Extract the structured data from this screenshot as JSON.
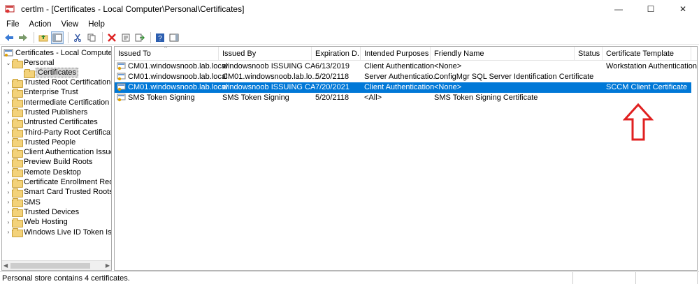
{
  "window": {
    "title": "certlm - [Certificates - Local Computer\\Personal\\Certificates]",
    "minimize": "—",
    "maximize": "☐",
    "close": "✕"
  },
  "menu": [
    "File",
    "Action",
    "View",
    "Help"
  ],
  "toolbar_icons": [
    "back-arrow-icon",
    "forward-arrow-icon",
    "up-folder-icon",
    "show-hide-tree-icon",
    "cut-icon",
    "copy-icon",
    "delete-icon",
    "properties-icon",
    "export-list-icon",
    "help-icon",
    "action-pane-icon"
  ],
  "tree": {
    "root": "Certificates - Local Computer",
    "personal": "Personal",
    "certificates": "Certificates",
    "stores": [
      "Trusted Root Certification Au",
      "Enterprise Trust",
      "Intermediate Certification Au",
      "Trusted Publishers",
      "Untrusted Certificates",
      "Third-Party Root Certification",
      "Trusted People",
      "Client Authentication Issuers",
      "Preview Build Roots",
      "Remote Desktop",
      "Certificate Enrollment Reques",
      "Smart Card Trusted Roots",
      "SMS",
      "Trusted Devices",
      "Web Hosting",
      "Windows Live ID Token Issuer"
    ]
  },
  "columns": [
    "Issued To",
    "Issued By",
    "Expiration D...",
    "Intended Purposes",
    "Friendly Name",
    "Status",
    "Certificate Template"
  ],
  "rows": [
    {
      "issued_to": "CM01.windowsnoob.lab.local",
      "issued_by": "windowsnoob ISSUING CA",
      "expiration": "6/13/2019",
      "purposes": "Client Authentication",
      "friendly": "<None>",
      "status": "",
      "template": "Workstation Authentication"
    },
    {
      "issued_to": "CM01.windowsnoob.lab.local",
      "issued_by": "CM01.windowsnoob.lab.lo...",
      "expiration": "5/20/2118",
      "purposes": "Server Authenticatio...",
      "friendly": "ConfigMgr SQL Server Identification Certificate",
      "status": "",
      "template": ""
    },
    {
      "issued_to": "CM01.windowsnoob.lab.local",
      "issued_by": "windowsnoob ISSUING CA",
      "expiration": "7/20/2021",
      "purposes": "Client Authentication",
      "friendly": "<None>",
      "status": "",
      "template": "SCCM Client Certificate"
    },
    {
      "issued_to": "SMS Token Signing",
      "issued_by": "SMS Token Signing",
      "expiration": "5/20/2118",
      "purposes": "<All>",
      "friendly": "SMS Token Signing Certificate",
      "status": "",
      "template": ""
    }
  ],
  "selected_row": 2,
  "status": "Personal store contains 4 certificates.",
  "colors": {
    "selection": "#0078d7",
    "annotation_arrow": "#e02020"
  }
}
